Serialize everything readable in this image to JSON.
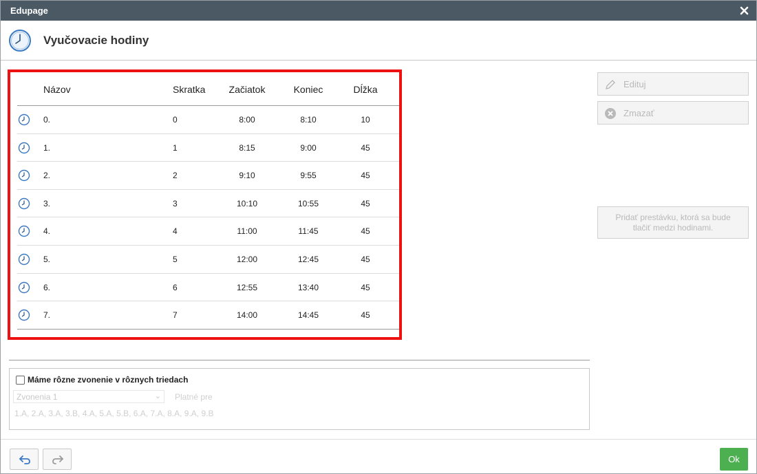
{
  "window": {
    "title": "Edupage"
  },
  "header": {
    "title": "Vyučovacie hodiny"
  },
  "table": {
    "columns": {
      "name": "Názov",
      "short": "Skratka",
      "start": "Začiatok",
      "end": "Koniec",
      "length": "Dĺžka"
    },
    "rows": [
      {
        "name": "0.",
        "short": "0",
        "start": "8:00",
        "end": "8:10",
        "length": "10"
      },
      {
        "name": "1.",
        "short": "1",
        "start": "8:15",
        "end": "9:00",
        "length": "45"
      },
      {
        "name": "2.",
        "short": "2",
        "start": "9:10",
        "end": "9:55",
        "length": "45"
      },
      {
        "name": "3.",
        "short": "3",
        "start": "10:10",
        "end": "10:55",
        "length": "45"
      },
      {
        "name": "4.",
        "short": "4",
        "start": "11:00",
        "end": "11:45",
        "length": "45"
      },
      {
        "name": "5.",
        "short": "5",
        "start": "12:00",
        "end": "12:45",
        "length": "45"
      },
      {
        "name": "6.",
        "short": "6",
        "start": "12:55",
        "end": "13:40",
        "length": "45"
      },
      {
        "name": "7.",
        "short": "7",
        "start": "14:00",
        "end": "14:45",
        "length": "45"
      }
    ]
  },
  "side": {
    "edit_label": "Edituj",
    "delete_label": "Zmazať",
    "break_line1": "Pridať prestávku, ktorá sa bude",
    "break_line2": "tlačiť medzi hodinami."
  },
  "options": {
    "checkbox_label": "Máme rôzne zvonenie v rôznych triedach",
    "bells_select": "Zvonenia 1",
    "valid_for": "Platné pre",
    "classes": "1.A, 2.A, 3.A, 3.B, 4.A, 5.A, 5.B, 6.A, 7.A, 8.A, 9.A, 9.B"
  },
  "footer": {
    "ok_label": "Ok"
  },
  "colors": {
    "titlebar": "#4a5964",
    "highlight": "#ee1111",
    "ok": "#4caf50",
    "clock": "#3a78c3"
  },
  "icons": [
    "close-icon",
    "clock-icon",
    "pencil-icon",
    "delete-circle-icon",
    "undo-icon",
    "redo-icon",
    "chevron-down-icon"
  ]
}
